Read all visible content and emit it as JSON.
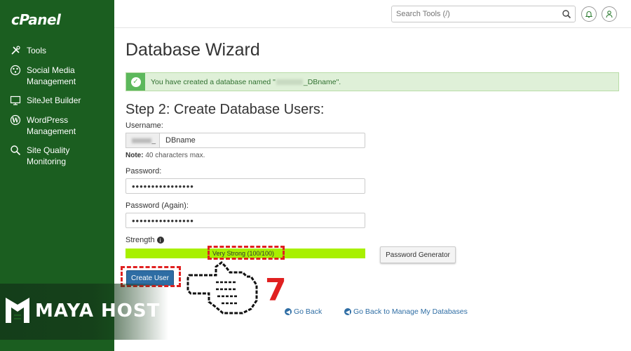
{
  "sidebar": {
    "logo": "cPanel",
    "items": [
      {
        "label": "Tools",
        "icon": "tools-icon"
      },
      {
        "label": "Social Media Management",
        "icon": "network-icon"
      },
      {
        "label": "SiteJet Builder",
        "icon": "monitor-icon"
      },
      {
        "label": "WordPress Management",
        "icon": "wordpress-icon"
      },
      {
        "label": "Site Quality Monitoring",
        "icon": "magnifier-icon"
      }
    ]
  },
  "header": {
    "search_placeholder": "Search Tools (/)"
  },
  "main": {
    "title": "Database Wizard",
    "alert": {
      "prefix": "You have created a database named \"",
      "suffix": "_DBname\"."
    },
    "step_title": "Step 2: Create Database Users:",
    "username_label": "Username:",
    "username_prefix": "_",
    "username_value": "DBname",
    "note_bold": "Note:",
    "note_text": " 40 characters max.",
    "password_label": "Password:",
    "password_value": "••••••••••••••••",
    "password_again_label": "Password (Again):",
    "password_again_value": "••••••••••••••••",
    "strength_label": "Strength",
    "strength_text": "Very Strong (100/100)",
    "strength_percent": 100,
    "password_generator_label": "Password Generator",
    "create_user_label": "Create User",
    "go_back_label": "Go Back",
    "go_back_manage_label": "Go Back to Manage My Databases"
  },
  "annotation": {
    "step_number": "7",
    "highlight_color": "#e02020"
  },
  "brand": {
    "name": "MAYA HOST"
  },
  "colors": {
    "sidebar_bg": "#1b5e20",
    "strength": "#a8f000",
    "primary": "#2e6da4",
    "success_bg": "#dff0d8"
  }
}
